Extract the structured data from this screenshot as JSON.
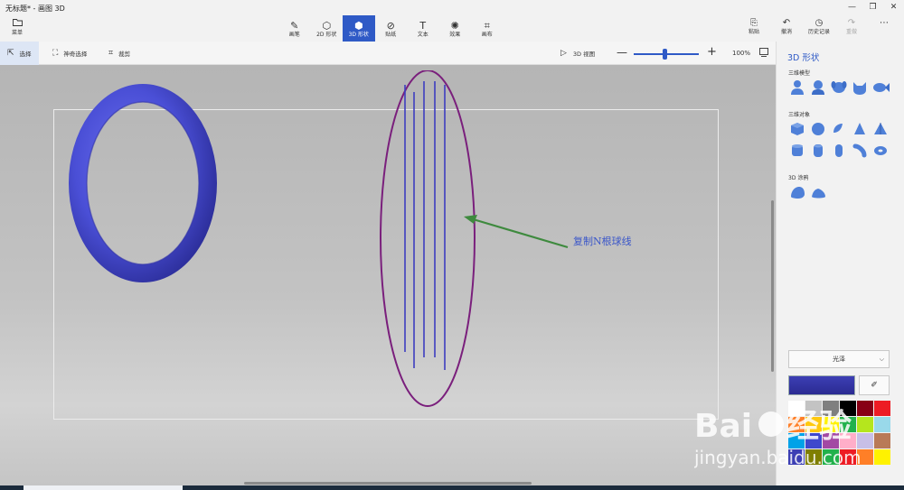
{
  "app": {
    "title": "无标题* - 画图 3D",
    "window_controls": [
      "—",
      "❐",
      "✕"
    ]
  },
  "menu": {
    "label": "菜单"
  },
  "toolbar": {
    "tools": [
      {
        "label": "画笔",
        "icon": "brush-icon",
        "glyph": "✎",
        "active": false
      },
      {
        "label": "2D 形状",
        "icon": "shapes2d-icon",
        "glyph": "⬡",
        "active": false
      },
      {
        "label": "3D 形状",
        "icon": "cube-icon",
        "glyph": "⬢",
        "active": true
      },
      {
        "label": "贴纸",
        "icon": "sticker-icon",
        "glyph": "⊘",
        "active": false
      },
      {
        "label": "文本",
        "icon": "text-icon",
        "glyph": "T",
        "active": false
      },
      {
        "label": "效果",
        "icon": "effects-icon",
        "glyph": "✺",
        "active": false
      },
      {
        "label": "画布",
        "icon": "canvas-icon",
        "glyph": "⌗",
        "active": false
      }
    ],
    "actions": [
      {
        "label": "粘贴",
        "icon": "paste-icon",
        "glyph": "⎘",
        "disabled": false
      },
      {
        "label": "撤消",
        "icon": "undo-icon",
        "glyph": "↶",
        "disabled": false
      },
      {
        "label": "历史记录",
        "icon": "history-icon",
        "glyph": "◷",
        "disabled": false
      },
      {
        "label": "重做",
        "icon": "redo-icon",
        "glyph": "↷",
        "disabled": true
      },
      {
        "label": "",
        "icon": "more-icon",
        "glyph": "⋯",
        "disabled": false
      }
    ]
  },
  "subbar": {
    "select": "选择",
    "magic_select": "神奇选择",
    "crop": "裁剪",
    "view_3d": "3D 视图",
    "zoom_minus": "—",
    "zoom_plus": "+",
    "zoom_level": "100%",
    "zoom_fraction": 0.48
  },
  "canvas": {
    "annotation": "复制N根球线"
  },
  "panel": {
    "title": "3D 形状",
    "sections": {
      "models": "三维模型",
      "objects": "三维对象",
      "doodle": "3D 涂鸦"
    },
    "material": "光泽",
    "eyedropper": "✐",
    "accent_color": "#2f5ac6",
    "selected_color": "#3c3fb4",
    "palette": [
      "#ffffff",
      "#c3c3c3",
      "#7f7f7f",
      "#000000",
      "#880015",
      "#ed1c24",
      "#ff7f27",
      "#ffc90e",
      "#fff200",
      "#22b14c",
      "#b5e61d",
      "#99d9ea",
      "#00a2e8",
      "#3f48cc",
      "#a349a4",
      "#ffaec9",
      "#c8bfe7",
      "#b97a57",
      "#3c3fb4",
      "#7f7f00",
      "#22b14c",
      "#ed1c24",
      "#ff7f27",
      "#fff200"
    ]
  }
}
